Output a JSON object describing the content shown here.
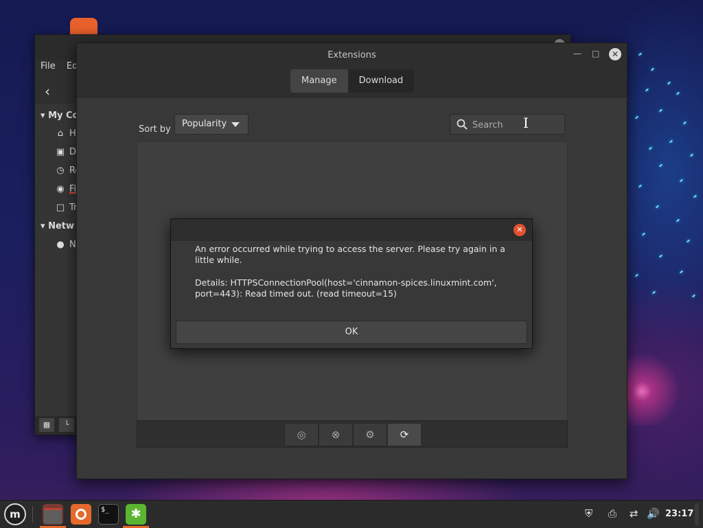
{
  "desktop": {},
  "file_manager": {
    "title": "",
    "menu": [
      "File",
      "Ed"
    ],
    "sidebar": {
      "section_mycomputer": "My Co",
      "items_mycomputer": [
        "Ho",
        "De",
        "Re",
        "Fi",
        "Tr"
      ],
      "section_network": "Netw",
      "items_network": [
        "N"
      ]
    }
  },
  "extensions": {
    "title": "Extensions",
    "tabs": [
      {
        "label": "Manage",
        "active": true
      },
      {
        "label": "Download",
        "active": false
      }
    ],
    "sort_label": "Sort by",
    "sort_value": "Popularity",
    "search_placeholder": "Search"
  },
  "dialog": {
    "message": "An error occurred while trying to access the server. Please try again in a little while.",
    "details": "Details:  HTTPSConnectionPool(host='cinnamon-spices.linuxmint.com', port=443): Read timed out. (read timeout=15)",
    "ok_label": "OK"
  },
  "taskbar": {
    "clock": "23:17"
  },
  "colors": {
    "accent_orange": "#e46a2c",
    "dialog_close_red": "#e2522f",
    "window_bg": "#383838"
  }
}
